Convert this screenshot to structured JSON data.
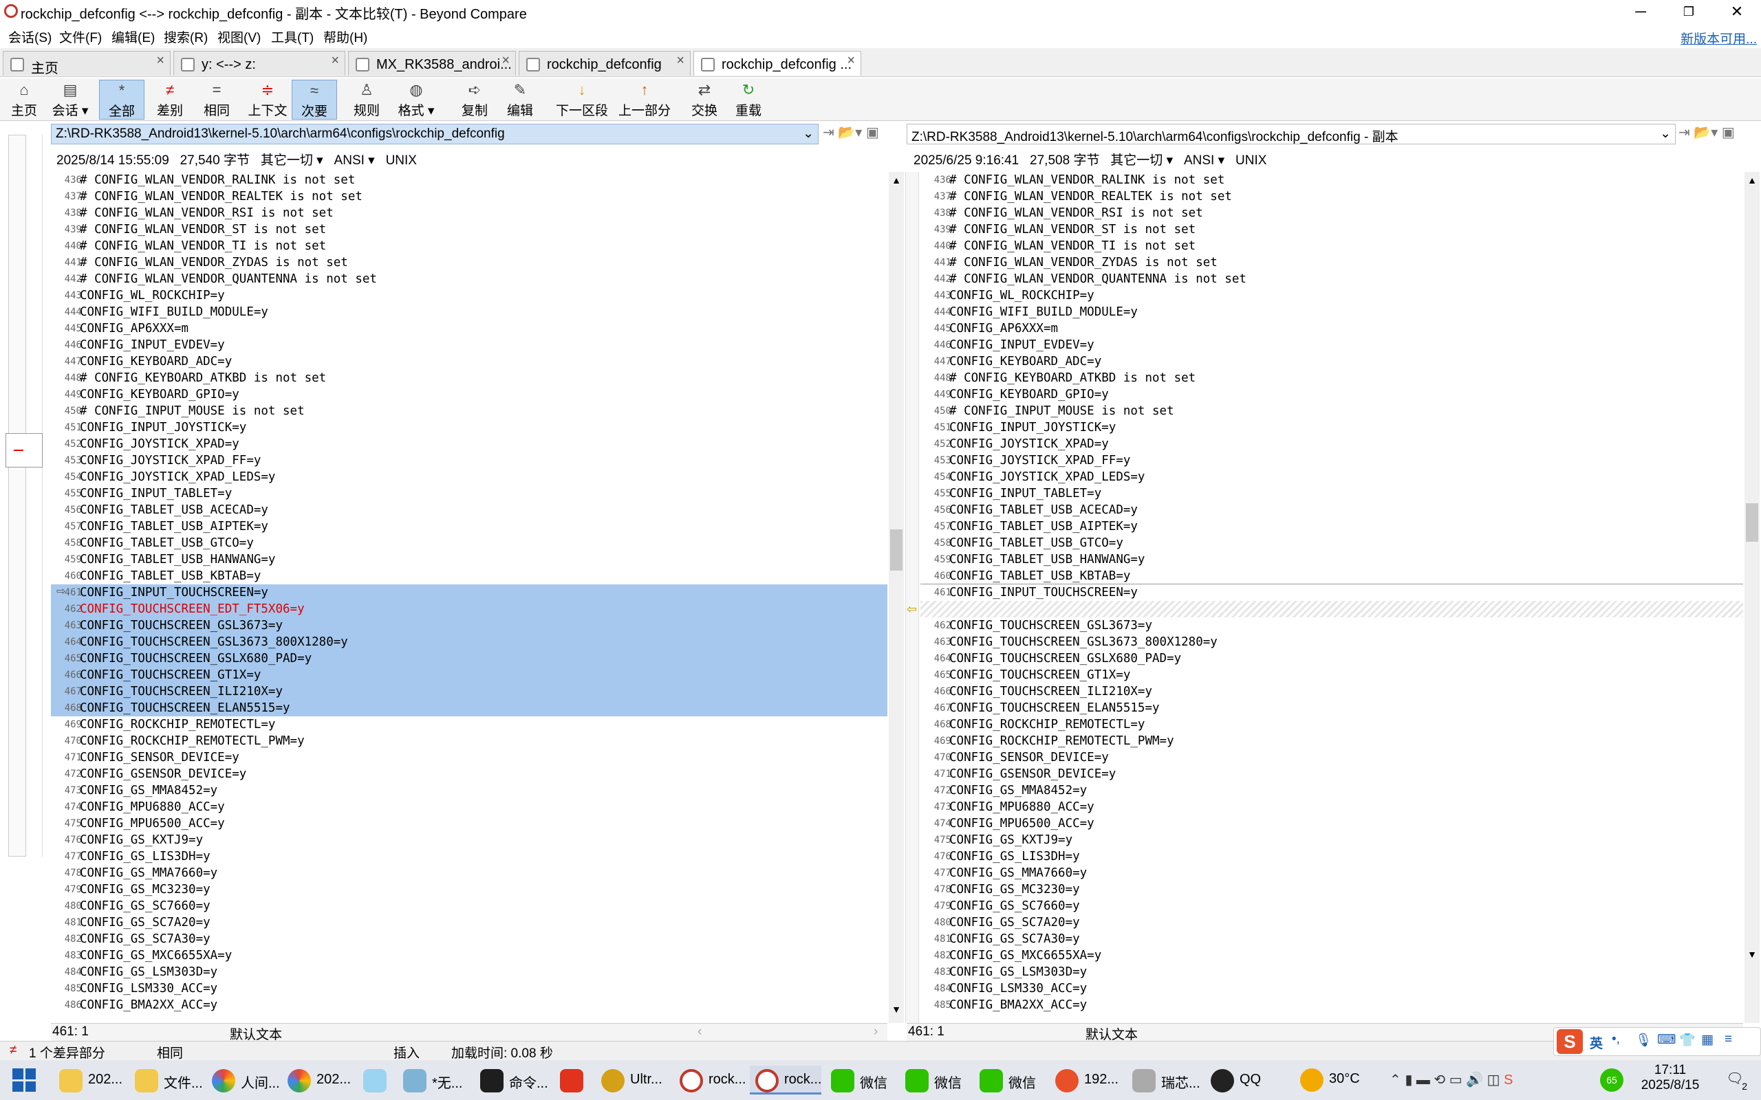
{
  "window": {
    "title": "rockchip_defconfig <--> rockchip_defconfig - 副本 - 文本比较(T) - Beyond Compare"
  },
  "menu": {
    "items": [
      "会话(S)",
      "文件(F)",
      "编辑(E)",
      "搜索(R)",
      "视图(V)",
      "工具(T)",
      "帮助(H)"
    ],
    "new_version": "新版本可用..."
  },
  "tabs": [
    "主页",
    "y: <--> z:",
    "MX_RK3588_androi...",
    "rockchip_defconfig",
    "rockchip_defconfig ..."
  ],
  "toolbar": [
    "主页",
    "会话",
    "全部",
    "差别",
    "相同",
    "上下文",
    "次要",
    "规则",
    "格式",
    "复制",
    "编辑",
    "下一区段",
    "上一部分",
    "交换",
    "重载"
  ],
  "left": {
    "path": "Z:\\RD-RK3588_Android13\\kernel-5.10\\arch\\arm64\\configs\\rockchip_defconfig",
    "date": "2025/8/14 15:55:09",
    "size": "27,540 字节",
    "filter": "其它一切",
    "encoding": "ANSI",
    "eol": "UNIX",
    "position": "461: 1",
    "format": "默认文本"
  },
  "right": {
    "path": "Z:\\RD-RK3588_Android13\\kernel-5.10\\arch\\arm64\\configs\\rockchip_defconfig - 副本",
    "date": "2025/6/25 9:16:41",
    "size": "27,508 字节",
    "filter": "其它一切",
    "encoding": "ANSI",
    "eol": "UNIX",
    "position": "461: 1",
    "format": "默认文本"
  },
  "left_lines": [
    [
      "436",
      "# CONFIG_WLAN_VENDOR_RALINK is not set"
    ],
    [
      "437",
      "# CONFIG_WLAN_VENDOR_REALTEK is not set"
    ],
    [
      "438",
      "# CONFIG_WLAN_VENDOR_RSI is not set"
    ],
    [
      "439",
      "# CONFIG_WLAN_VENDOR_ST is not set"
    ],
    [
      "440",
      "# CONFIG_WLAN_VENDOR_TI is not set"
    ],
    [
      "441",
      "# CONFIG_WLAN_VENDOR_ZYDAS is not set"
    ],
    [
      "442",
      "# CONFIG_WLAN_VENDOR_QUANTENNA is not set"
    ],
    [
      "443",
      "CONFIG_WL_ROCKCHIP=y"
    ],
    [
      "444",
      "CONFIG_WIFI_BUILD_MODULE=y"
    ],
    [
      "445",
      "CONFIG_AP6XXX=m"
    ],
    [
      "446",
      "CONFIG_INPUT_EVDEV=y"
    ],
    [
      "447",
      "CONFIG_KEYBOARD_ADC=y"
    ],
    [
      "448",
      "# CONFIG_KEYBOARD_ATKBD is not set"
    ],
    [
      "449",
      "CONFIG_KEYBOARD_GPIO=y"
    ],
    [
      "450",
      "# CONFIG_INPUT_MOUSE is not set"
    ],
    [
      "451",
      "CONFIG_INPUT_JOYSTICK=y"
    ],
    [
      "452",
      "CONFIG_JOYSTICK_XPAD=y"
    ],
    [
      "453",
      "CONFIG_JOYSTICK_XPAD_FF=y"
    ],
    [
      "454",
      "CONFIG_JOYSTICK_XPAD_LEDS=y"
    ],
    [
      "455",
      "CONFIG_INPUT_TABLET=y"
    ],
    [
      "456",
      "CONFIG_TABLET_USB_ACECAD=y"
    ],
    [
      "457",
      "CONFIG_TABLET_USB_AIPTEK=y"
    ],
    [
      "458",
      "CONFIG_TABLET_USB_GTCO=y"
    ],
    [
      "459",
      "CONFIG_TABLET_USB_HANWANG=y"
    ],
    [
      "460",
      "CONFIG_TABLET_USB_KBTAB=y"
    ],
    [
      "461",
      "CONFIG_INPUT_TOUCHSCREEN=y"
    ],
    [
      "462",
      "CONFIG_TOUCHSCREEN_EDT_FT5X06=y"
    ],
    [
      "463",
      "CONFIG_TOUCHSCREEN_GSL3673=y"
    ],
    [
      "464",
      "CONFIG_TOUCHSCREEN_GSL3673_800X1280=y"
    ],
    [
      "465",
      "CONFIG_TOUCHSCREEN_GSLX680_PAD=y"
    ],
    [
      "466",
      "CONFIG_TOUCHSCREEN_GT1X=y"
    ],
    [
      "467",
      "CONFIG_TOUCHSCREEN_ILI210X=y"
    ],
    [
      "468",
      "CONFIG_TOUCHSCREEN_ELAN5515=y"
    ],
    [
      "469",
      "CONFIG_ROCKCHIP_REMOTECTL=y"
    ],
    [
      "470",
      "CONFIG_ROCKCHIP_REMOTECTL_PWM=y"
    ],
    [
      "471",
      "CONFIG_SENSOR_DEVICE=y"
    ],
    [
      "472",
      "CONFIG_GSENSOR_DEVICE=y"
    ],
    [
      "473",
      "CONFIG_GS_MMA8452=y"
    ],
    [
      "474",
      "CONFIG_MPU6880_ACC=y"
    ],
    [
      "475",
      "CONFIG_MPU6500_ACC=y"
    ],
    [
      "476",
      "CONFIG_GS_KXTJ9=y"
    ],
    [
      "477",
      "CONFIG_GS_LIS3DH=y"
    ],
    [
      "478",
      "CONFIG_GS_MMA7660=y"
    ],
    [
      "479",
      "CONFIG_GS_MC3230=y"
    ],
    [
      "480",
      "CONFIG_GS_SC7660=y"
    ],
    [
      "481",
      "CONFIG_GS_SC7A20=y"
    ],
    [
      "482",
      "CONFIG_GS_SC7A30=y"
    ],
    [
      "483",
      "CONFIG_GS_MXC6655XA=y"
    ],
    [
      "484",
      "CONFIG_GS_LSM303D=y"
    ],
    [
      "485",
      "CONFIG_LSM330_ACC=y"
    ],
    [
      "486",
      "CONFIG_BMA2XX_ACC=y"
    ]
  ],
  "right_lines": [
    [
      "436",
      "# CONFIG_WLAN_VENDOR_RALINK is not set"
    ],
    [
      "437",
      "# CONFIG_WLAN_VENDOR_REALTEK is not set"
    ],
    [
      "438",
      "# CONFIG_WLAN_VENDOR_RSI is not set"
    ],
    [
      "439",
      "# CONFIG_WLAN_VENDOR_ST is not set"
    ],
    [
      "440",
      "# CONFIG_WLAN_VENDOR_TI is not set"
    ],
    [
      "441",
      "# CONFIG_WLAN_VENDOR_ZYDAS is not set"
    ],
    [
      "442",
      "# CONFIG_WLAN_VENDOR_QUANTENNA is not set"
    ],
    [
      "443",
      "CONFIG_WL_ROCKCHIP=y"
    ],
    [
      "444",
      "CONFIG_WIFI_BUILD_MODULE=y"
    ],
    [
      "445",
      "CONFIG_AP6XXX=m"
    ],
    [
      "446",
      "CONFIG_INPUT_EVDEV=y"
    ],
    [
      "447",
      "CONFIG_KEYBOARD_ADC=y"
    ],
    [
      "448",
      "# CONFIG_KEYBOARD_ATKBD is not set"
    ],
    [
      "449",
      "CONFIG_KEYBOARD_GPIO=y"
    ],
    [
      "450",
      "# CONFIG_INPUT_MOUSE is not set"
    ],
    [
      "451",
      "CONFIG_INPUT_JOYSTICK=y"
    ],
    [
      "452",
      "CONFIG_JOYSTICK_XPAD=y"
    ],
    [
      "453",
      "CONFIG_JOYSTICK_XPAD_FF=y"
    ],
    [
      "454",
      "CONFIG_JOYSTICK_XPAD_LEDS=y"
    ],
    [
      "455",
      "CONFIG_INPUT_TABLET=y"
    ],
    [
      "456",
      "CONFIG_TABLET_USB_ACECAD=y"
    ],
    [
      "457",
      "CONFIG_TABLET_USB_AIPTEK=y"
    ],
    [
      "458",
      "CONFIG_TABLET_USB_GTCO=y"
    ],
    [
      "459",
      "CONFIG_TABLET_USB_HANWANG=y"
    ],
    [
      "460",
      "CONFIG_TABLET_USB_KBTAB=y"
    ],
    [
      "461",
      "CONFIG_INPUT_TOUCHSCREEN=y"
    ],
    [
      "",
      ""
    ],
    [
      "462",
      "CONFIG_TOUCHSCREEN_GSL3673=y"
    ],
    [
      "463",
      "CONFIG_TOUCHSCREEN_GSL3673_800X1280=y"
    ],
    [
      "464",
      "CONFIG_TOUCHSCREEN_GSLX680_PAD=y"
    ],
    [
      "465",
      "CONFIG_TOUCHSCREEN_GT1X=y"
    ],
    [
      "466",
      "CONFIG_TOUCHSCREEN_ILI210X=y"
    ],
    [
      "467",
      "CONFIG_TOUCHSCREEN_ELAN5515=y"
    ],
    [
      "468",
      "CONFIG_ROCKCHIP_REMOTECTL=y"
    ],
    [
      "469",
      "CONFIG_ROCKCHIP_REMOTECTL_PWM=y"
    ],
    [
      "470",
      "CONFIG_SENSOR_DEVICE=y"
    ],
    [
      "471",
      "CONFIG_GSENSOR_DEVICE=y"
    ],
    [
      "472",
      "CONFIG_GS_MMA8452=y"
    ],
    [
      "473",
      "CONFIG_MPU6880_ACC=y"
    ],
    [
      "474",
      "CONFIG_MPU6500_ACC=y"
    ],
    [
      "475",
      "CONFIG_GS_KXTJ9=y"
    ],
    [
      "476",
      "CONFIG_GS_LIS3DH=y"
    ],
    [
      "477",
      "CONFIG_GS_MMA7660=y"
    ],
    [
      "478",
      "CONFIG_GS_MC3230=y"
    ],
    [
      "479",
      "CONFIG_GS_SC7660=y"
    ],
    [
      "480",
      "CONFIG_GS_SC7A20=y"
    ],
    [
      "481",
      "CONFIG_GS_SC7A30=y"
    ],
    [
      "482",
      "CONFIG_GS_MXC6655XA=y"
    ],
    [
      "483",
      "CONFIG_GS_LSM303D=y"
    ],
    [
      "484",
      "CONFIG_LSM330_ACC=y"
    ],
    [
      "485",
      "CONFIG_BMA2XX_ACC=y"
    ]
  ],
  "status": {
    "diff_count": "1 个差异部分",
    "same": "相同",
    "insert": "插入",
    "load_time": "加载时间: 0.08 秒"
  },
  "taskbar": {
    "items": [
      "202...",
      "文件...",
      "人间...",
      "202...",
      "",
      "*无...",
      "命令...",
      "",
      "Ultr...",
      "rock...",
      "rock...",
      "微信",
      "微信",
      "微信",
      "192...",
      "瑞芯...",
      "QQ"
    ],
    "weather": "30°C",
    "ime": "英",
    "time": "17:11",
    "date": "2025/8/15",
    "notif": "2",
    "wechat_badge": "65"
  },
  "colors": {
    "selection": "#a6c8ee",
    "diff_text": "#e00000",
    "accent": "#1a5fb4"
  }
}
